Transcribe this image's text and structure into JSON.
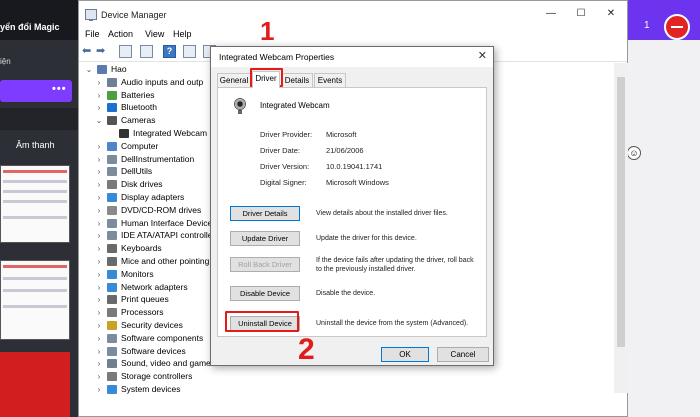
{
  "bg_left": {
    "header_text": "yển đổi Magic",
    "nav_text": "iện",
    "more_dots": "•••",
    "section_text": "Âm thanh"
  },
  "bg_right": {
    "counter": "1"
  },
  "device_manager": {
    "title": "Device Manager",
    "window_buttons": {
      "minimize": "—",
      "maximize": "☐",
      "close": "✕"
    },
    "menu": [
      "File",
      "Action",
      "View",
      "Help"
    ],
    "tree": [
      {
        "label": "Hao",
        "level": 0,
        "expanded": true,
        "icon": "computer-icon",
        "color": "#5b7bb0"
      },
      {
        "label": "Audio inputs and outp",
        "level": 1,
        "icon": "speaker-icon",
        "color": "#6f7f94"
      },
      {
        "label": "Batteries",
        "level": 1,
        "icon": "battery-icon",
        "color": "#4aa042"
      },
      {
        "label": "Bluetooth",
        "level": 1,
        "icon": "bluetooth-icon",
        "color": "#1f6fd1"
      },
      {
        "label": "Cameras",
        "level": 1,
        "expanded": true,
        "icon": "camera-icon",
        "color": "#555555"
      },
      {
        "label": "Integrated Webcam",
        "level": 2,
        "icon": "webcam-icon",
        "color": "#333333"
      },
      {
        "label": "Computer",
        "level": 1,
        "icon": "monitor-icon",
        "color": "#4f86c6"
      },
      {
        "label": "DellInstrumentation",
        "level": 1,
        "icon": "device-icon",
        "color": "#7c8ca0"
      },
      {
        "label": "DellUtils",
        "level": 1,
        "icon": "device-icon",
        "color": "#7c8ca0"
      },
      {
        "label": "Disk drives",
        "level": 1,
        "icon": "disk-icon",
        "color": "#7a7a7a"
      },
      {
        "label": "Display adapters",
        "level": 1,
        "icon": "display-icon",
        "color": "#3a8bd6"
      },
      {
        "label": "DVD/CD-ROM drives",
        "level": 1,
        "icon": "dvd-icon",
        "color": "#8a8a8a"
      },
      {
        "label": "Human Interface Device",
        "level": 1,
        "icon": "hid-icon",
        "color": "#7c8ca0"
      },
      {
        "label": "IDE ATA/ATAPI controlle",
        "level": 1,
        "icon": "controller-icon",
        "color": "#7c8ca0"
      },
      {
        "label": "Keyboards",
        "level": 1,
        "icon": "keyboard-icon",
        "color": "#6a6a6a"
      },
      {
        "label": "Mice and other pointing",
        "level": 1,
        "icon": "mouse-icon",
        "color": "#6a6a6a"
      },
      {
        "label": "Monitors",
        "level": 1,
        "icon": "monitor-icon",
        "color": "#3a8bd6"
      },
      {
        "label": "Network adapters",
        "level": 1,
        "icon": "network-icon",
        "color": "#3a8bd6"
      },
      {
        "label": "Print queues",
        "level": 1,
        "icon": "printer-icon",
        "color": "#6a6a6a"
      },
      {
        "label": "Processors",
        "level": 1,
        "icon": "processor-icon",
        "color": "#7a7a7a"
      },
      {
        "label": "Security devices",
        "level": 1,
        "icon": "security-icon",
        "color": "#c9a227"
      },
      {
        "label": "Software components",
        "level": 1,
        "icon": "component-icon",
        "color": "#7c8ca0"
      },
      {
        "label": "Software devices",
        "level": 1,
        "icon": "device-icon",
        "color": "#7c8ca0"
      },
      {
        "label": "Sound, video and game",
        "level": 1,
        "icon": "sound-icon",
        "color": "#6f7f94"
      },
      {
        "label": "Storage controllers",
        "level": 1,
        "icon": "storage-icon",
        "color": "#7a7a7a"
      },
      {
        "label": "System devices",
        "level": 1,
        "icon": "system-icon",
        "color": "#3a8bd6"
      }
    ]
  },
  "dialog": {
    "title": "Integrated Webcam Properties",
    "close": "✕",
    "tabs": [
      "General",
      "Driver",
      "Details",
      "Events"
    ],
    "device_name": "Integrated Webcam",
    "info": [
      {
        "key": "Driver Provider:",
        "value": "Microsoft"
      },
      {
        "key": "Driver Date:",
        "value": "21/06/2006"
      },
      {
        "key": "Driver Version:",
        "value": "10.0.19041.1741"
      },
      {
        "key": "Digital Signer:",
        "value": "Microsoft Windows"
      }
    ],
    "actions": [
      {
        "label": "Driver Details",
        "desc": "View details about the installed driver files.",
        "state": "focus"
      },
      {
        "label": "Update Driver",
        "desc": "Update the driver for this device.",
        "state": "normal"
      },
      {
        "label": "Roll Back Driver",
        "desc": "If the device fails after updating the driver, roll back to the previously installed driver.",
        "state": "disabled"
      },
      {
        "label": "Disable Device",
        "desc": "Disable the device.",
        "state": "normal"
      },
      {
        "label": "Uninstall Device",
        "desc": "Uninstall the device from the system (Advanced).",
        "state": "normal"
      }
    ],
    "ok": "OK",
    "cancel": "Cancel"
  },
  "annotations": {
    "step1": "1",
    "step2": "2",
    "color": "#e31b1b"
  }
}
